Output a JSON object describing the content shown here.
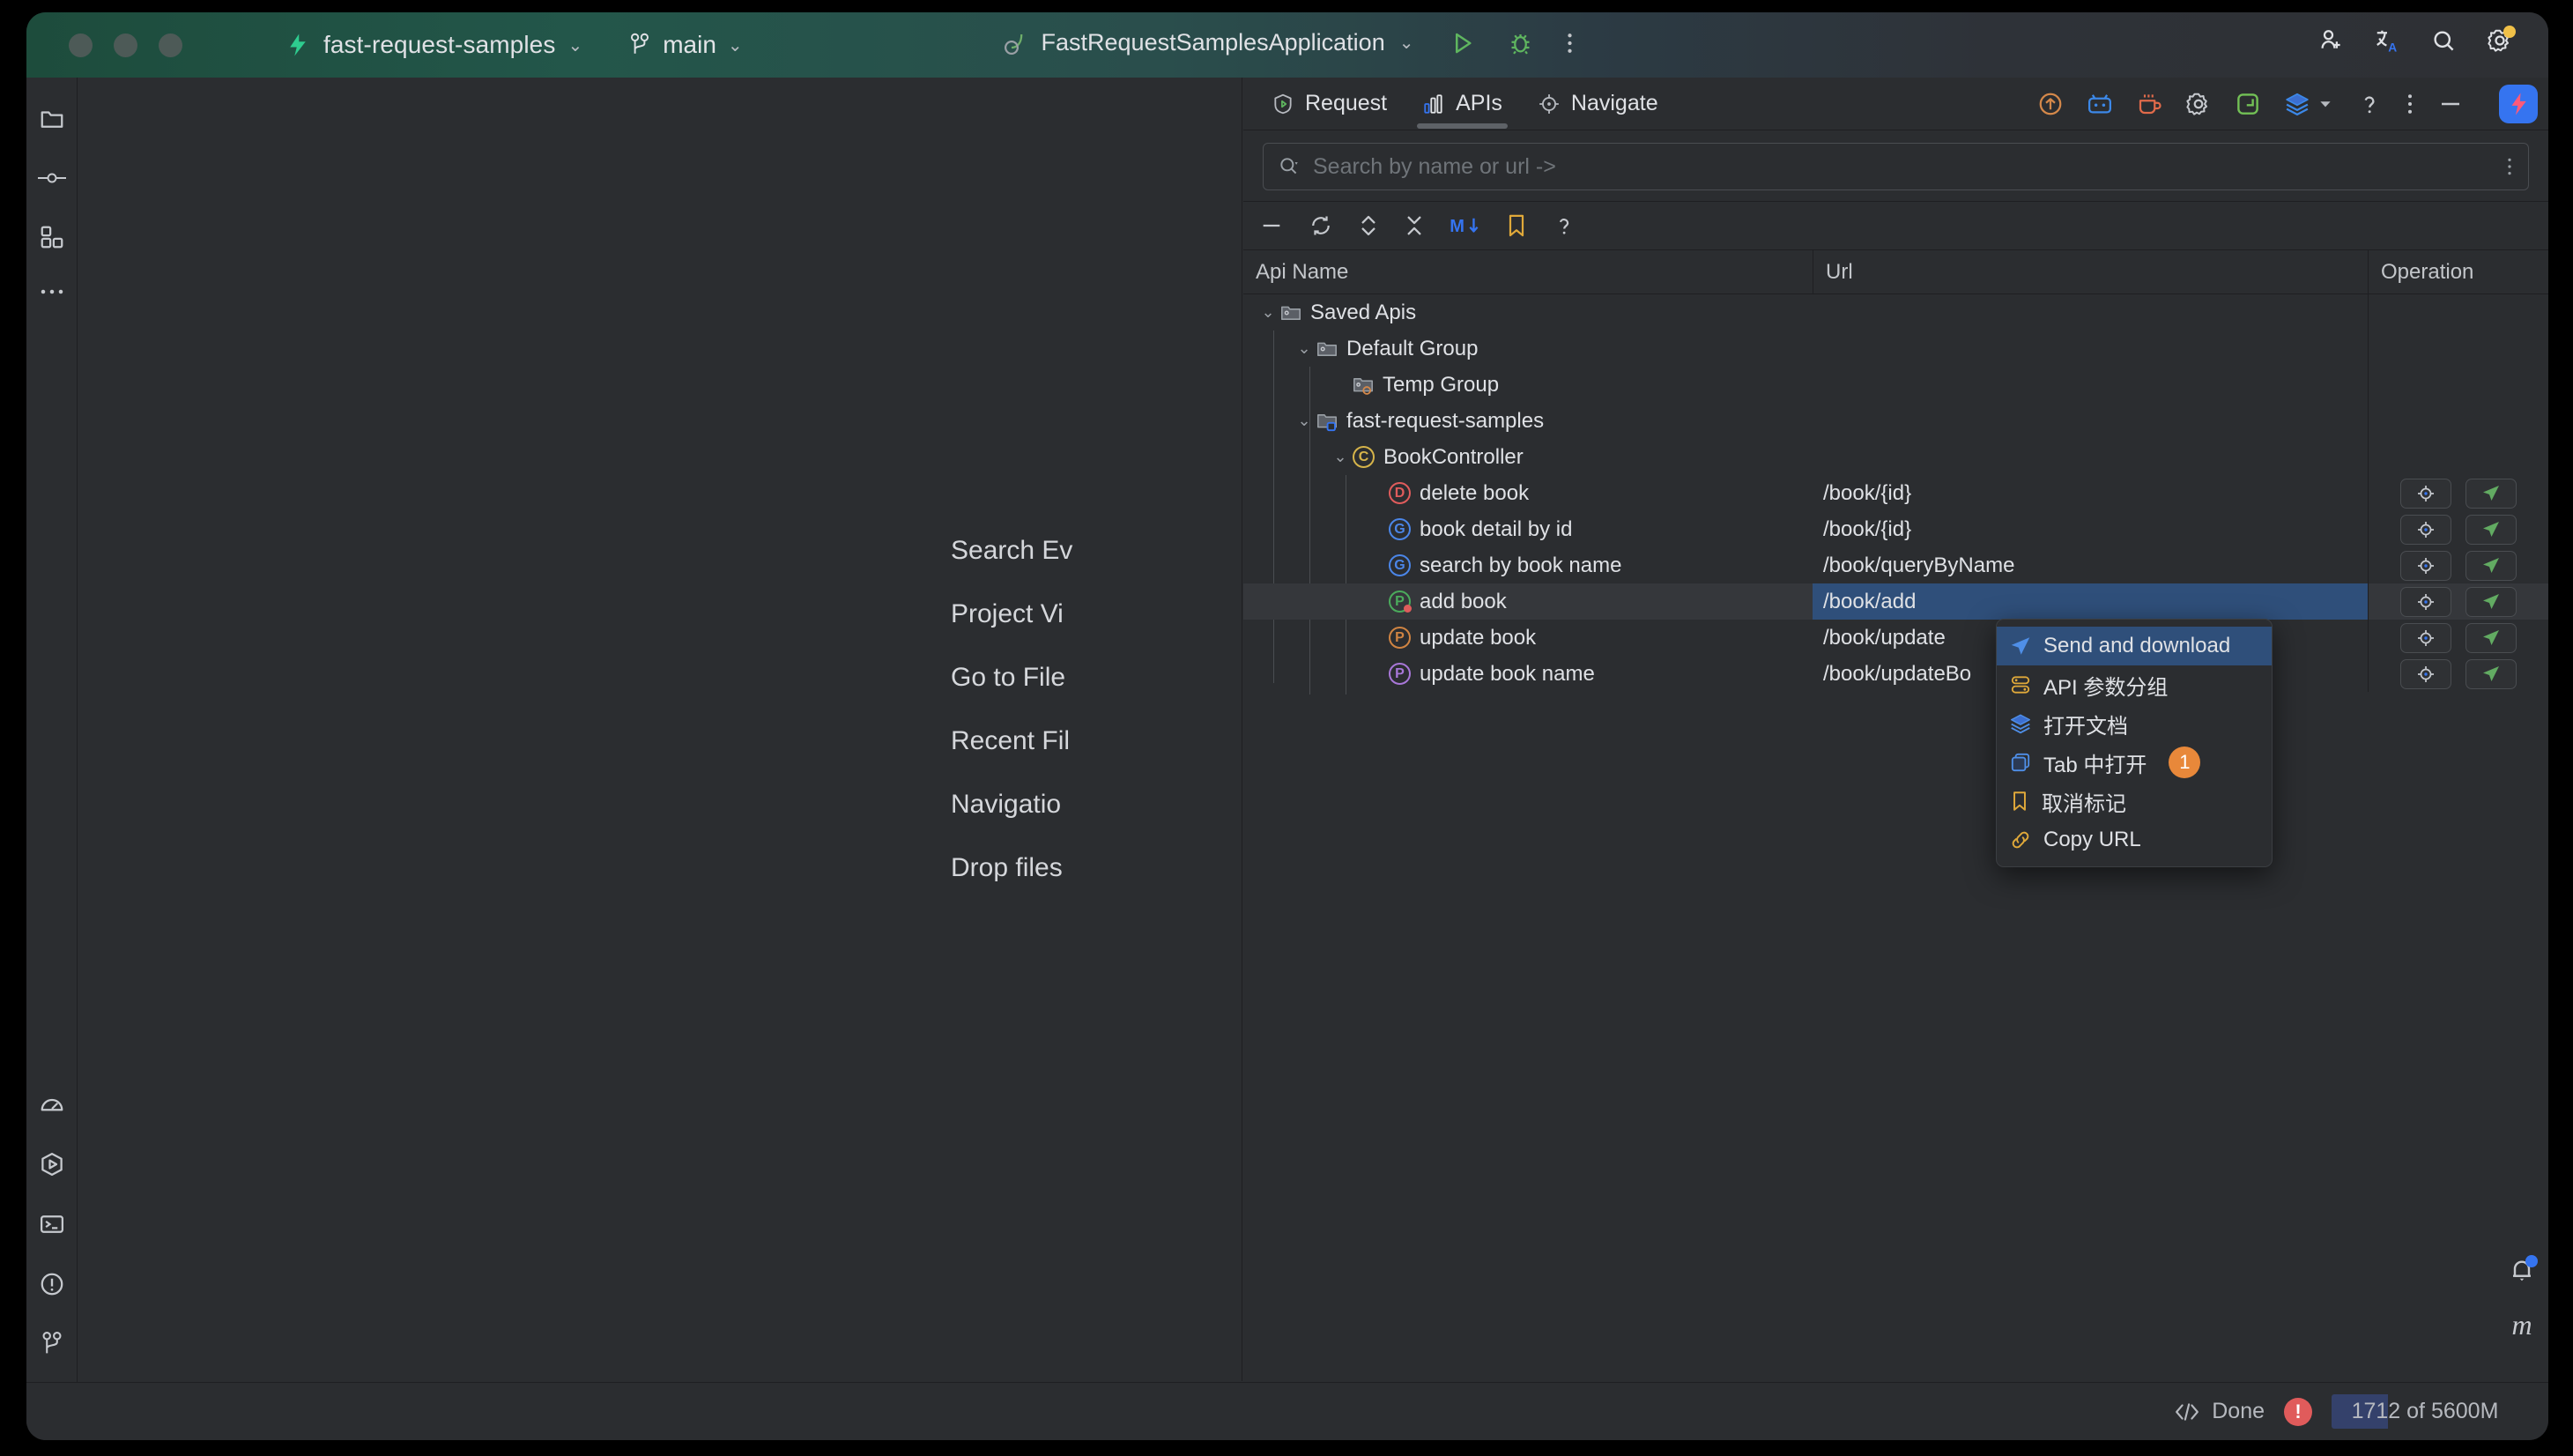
{
  "titlebar": {
    "project_name": "fast-request-samples",
    "project_icon": "fast-request-logo-icon",
    "branch_name": "main",
    "branch_icon": "git-branch-icon",
    "run_config": "FastRequestSamplesApplication",
    "run_config_icon": "spring-leaf-icon",
    "actions": [
      {
        "name": "run-button",
        "icon": "play-icon"
      },
      {
        "name": "debug-button",
        "icon": "bug-icon"
      },
      {
        "name": "more-actions-button",
        "icon": "vertical-dots-icon"
      },
      {
        "name": "code-with-me-button",
        "icon": "person-plus-icon"
      },
      {
        "name": "translate-button",
        "icon": "translate-icon"
      },
      {
        "name": "search-everywhere-button",
        "icon": "magnifier-icon"
      },
      {
        "name": "settings-button",
        "icon": "gear-icon"
      }
    ]
  },
  "left_stripe": {
    "top_items": [
      {
        "name": "project-tool-button",
        "icon": "folder-icon"
      },
      {
        "name": "commit-tool-button",
        "icon": "commit-icon"
      },
      {
        "name": "structure-tool-button",
        "icon": "blocks-icon"
      },
      {
        "name": "more-tool-windows-button",
        "icon": "ellipsis-icon"
      }
    ],
    "bottom_items": [
      {
        "name": "profiler-tool-button",
        "icon": "gauge-icon"
      },
      {
        "name": "run-tool-button",
        "icon": "run-hexagon-icon"
      },
      {
        "name": "terminal-tool-button",
        "icon": "terminal-icon"
      },
      {
        "name": "problems-tool-button",
        "icon": "warning-circle-icon"
      },
      {
        "name": "version-control-tool-button",
        "icon": "git-branch-icon"
      }
    ]
  },
  "editor": {
    "hints": [
      "Search Ev",
      "Project Vi",
      "Go to File",
      "Recent Fil",
      "Navigatio",
      "Drop files"
    ]
  },
  "tool_window": {
    "tabs": [
      {
        "label": "Request",
        "icon": "request-shield-icon",
        "active": false
      },
      {
        "label": "APIs",
        "icon": "apis-chart-icon",
        "active": true
      },
      {
        "label": "Navigate",
        "icon": "navigate-target-icon",
        "active": false
      }
    ],
    "toolbar_actions": [
      {
        "name": "upload-button",
        "icon": "arrow-up-circle-icon"
      },
      {
        "name": "bilibili-button",
        "icon": "tv-icon"
      },
      {
        "name": "coffee-button",
        "icon": "coffee-cup-icon"
      },
      {
        "name": "settings-button",
        "icon": "gear-icon"
      },
      {
        "name": "fullscreen-button",
        "icon": "expand-frame-icon"
      },
      {
        "name": "layers-button",
        "icon": "layers-icon"
      },
      {
        "name": "layers-dropdown-button",
        "icon": "chevron-down-icon"
      },
      {
        "name": "help-button",
        "icon": "question-mark-icon"
      },
      {
        "name": "more-options-button",
        "icon": "vertical-dots-icon"
      },
      {
        "name": "hide-button",
        "icon": "minus-icon"
      }
    ],
    "logo_icon": "fast-request-logo-icon",
    "search": {
      "placeholder": "Search by name or url ->",
      "value": "",
      "leading_icon": "search-dropdown-icon",
      "trailing_icon": "vertical-dots-icon"
    },
    "tree_toolbar": [
      {
        "name": "collapse-button",
        "icon": "minus-icon"
      },
      {
        "name": "refresh-button",
        "icon": "refresh-icon"
      },
      {
        "name": "expand-all-button",
        "icon": "expand-chevrons-icon"
      },
      {
        "name": "collapse-all-button",
        "icon": "collapse-chevrons-icon"
      },
      {
        "name": "export-markdown-button",
        "icon": "markdown-down-icon",
        "label": "M"
      },
      {
        "name": "bookmarks-button",
        "icon": "bookmark-icon"
      },
      {
        "name": "help-button",
        "icon": "question-mark-icon"
      }
    ],
    "table": {
      "columns": [
        "Api Name",
        "Url",
        "Operation"
      ],
      "rows": [
        {
          "label": "Saved Apis",
          "url": "",
          "depth": 0,
          "icon": "folder-module-icon",
          "twisty": "expanded",
          "has_ops": false,
          "selected": false
        },
        {
          "label": "Default Group",
          "url": "",
          "depth": 1,
          "icon": "folder-module-icon",
          "twisty": "expanded",
          "has_ops": false,
          "selected": false
        },
        {
          "label": "Temp Group",
          "url": "",
          "depth": 2,
          "icon": "folder-temp-icon",
          "twisty": "none",
          "has_ops": false,
          "selected": false
        },
        {
          "label": "fast-request-samples",
          "url": "",
          "depth": 1,
          "icon": "folder-project-icon",
          "twisty": "expanded",
          "has_ops": false,
          "selected": false
        },
        {
          "label": "BookController",
          "url": "",
          "depth": 2,
          "icon": "class-icon",
          "twisty": "expanded",
          "has_ops": false,
          "selected": false
        },
        {
          "label": "delete book",
          "url": "/book/{id}",
          "depth": 3,
          "icon": "method-delete-icon",
          "twisty": "none",
          "has_ops": true,
          "selected": false
        },
        {
          "label": "book detail by id",
          "url": "/book/{id}",
          "depth": 3,
          "icon": "method-get-icon",
          "twisty": "none",
          "has_ops": true,
          "selected": false
        },
        {
          "label": "search by book name",
          "url": "/book/queryByName",
          "depth": 3,
          "icon": "method-get-icon",
          "twisty": "none",
          "has_ops": true,
          "selected": false
        },
        {
          "label": "add book",
          "url": "/book/add",
          "depth": 3,
          "icon": "method-post-icon",
          "twisty": "none",
          "has_ops": true,
          "selected": true
        },
        {
          "label": "update book",
          "url": "/book/update",
          "depth": 3,
          "icon": "method-put-icon",
          "twisty": "none",
          "has_ops": true,
          "selected": false
        },
        {
          "label": "update book name",
          "url": "/book/updateBo",
          "depth": 3,
          "icon": "method-patch-icon",
          "twisty": "none",
          "has_ops": true,
          "selected": false
        }
      ],
      "row_operations": [
        {
          "name": "locate-api-button",
          "icon": "crosshair-icon"
        },
        {
          "name": "send-request-button",
          "icon": "send-plane-icon"
        }
      ]
    }
  },
  "context_menu": {
    "items": [
      {
        "label": "Send and download",
        "icon": "send-plane-icon",
        "highlighted": true,
        "badge": ""
      },
      {
        "label": "API 参数分组",
        "icon": "server-group-icon",
        "highlighted": false,
        "badge": ""
      },
      {
        "label": "打开文档",
        "icon": "layers-icon",
        "highlighted": false,
        "badge": ""
      },
      {
        "label": "Tab 中打开",
        "icon": "window-tab-icon",
        "highlighted": false,
        "badge": "1"
      },
      {
        "label": "取消标记",
        "icon": "bookmark-icon",
        "highlighted": false,
        "badge": ""
      },
      {
        "label": "Copy URL",
        "icon": "link-icon",
        "highlighted": false,
        "badge": ""
      }
    ]
  },
  "right_stripe": {
    "notifications_icon": "bell-icon",
    "maven_label": "m"
  },
  "status_bar": {
    "done_label": "Done",
    "done_icon": "code-brackets-icon",
    "error_badge": "!",
    "memory_label": "1712 of 5600M",
    "memory_percent": 30
  },
  "colors": {
    "accent_blue": "#3574f0",
    "selection_blue": "#2f4f7a",
    "badge_orange": "#e8883a",
    "error_red": "#e05b5b",
    "panel_bg": "#2b2d30",
    "get_blue": "#4b86e8",
    "post_green": "#4bab5c",
    "put_orange": "#d08442",
    "patch_purple": "#a877d8",
    "delete_red": "#e05c5c"
  }
}
